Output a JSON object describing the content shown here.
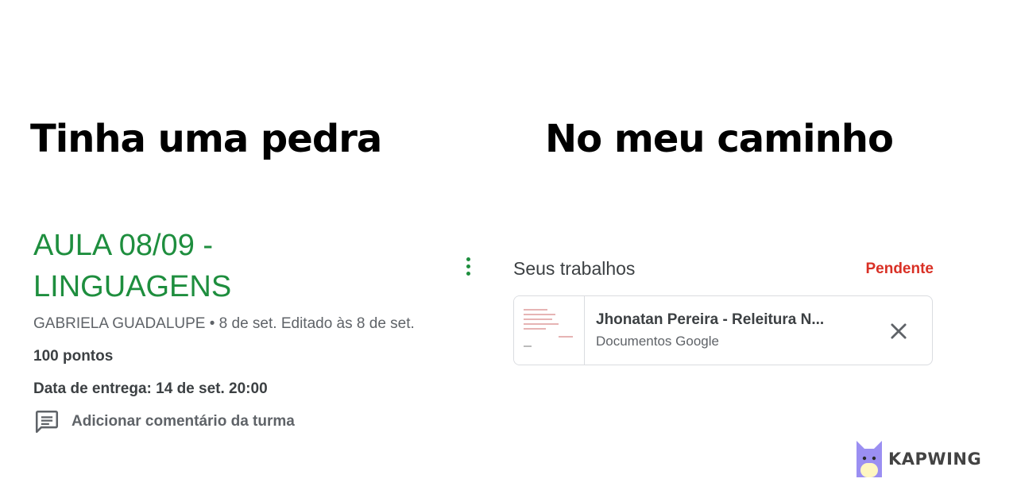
{
  "meme": {
    "caption_left": "Tinha uma pedra",
    "caption_right": "No meu caminho"
  },
  "assignment": {
    "title": "AULA 08/09 - LINGUAGENS",
    "meta": "GABRIELA GUADALUPE • 8 de set. Editado às 8 de set.",
    "points": "100 pontos",
    "due": "Data de entrega: 14 de set. 20:00",
    "comment_label": "Adicionar comentário da turma"
  },
  "work": {
    "heading": "Seus trabalhos",
    "status": "Pendente",
    "attachment": {
      "title": "Jhonatan Pereira - Releitura N...",
      "type": "Documentos Google"
    }
  },
  "watermark": {
    "text": "KAPWING"
  },
  "colors": {
    "title_green": "#1e8e3e",
    "status_red": "#d93025",
    "text_dark": "#3c4043",
    "text_gray": "#5f6368"
  },
  "icons": [
    "more-vert-icon",
    "comment-icon",
    "close-icon",
    "doc-thumbnail",
    "kapwing-logo"
  ]
}
